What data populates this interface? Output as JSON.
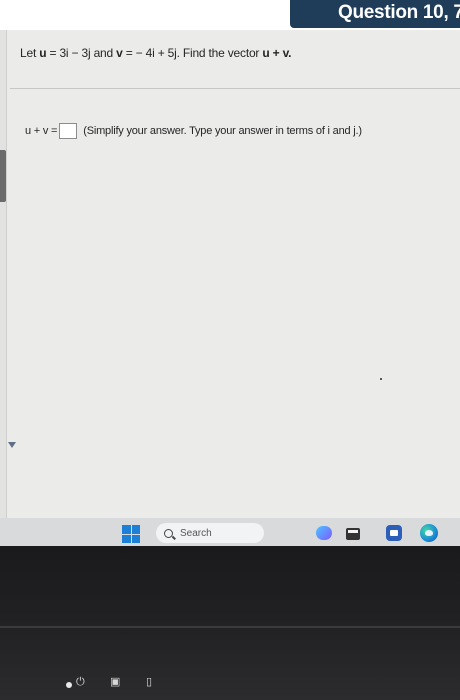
{
  "header": {
    "title": "Question 10, 7.",
    "back_label": "<"
  },
  "question": {
    "let": "Let",
    "u_name": "u",
    "eq1": " = 3i − 3j",
    "and": "and",
    "v_name": "v",
    "eq2": " = − 4i + 5j.",
    "find": "Find the vector",
    "target": "u + v."
  },
  "answer": {
    "prefix": "u + v =",
    "value": "",
    "hint": "(Simplify your answer. Type your answer in terms of i and j.)"
  },
  "taskbar": {
    "search_label": "Search"
  },
  "colors": {
    "header_bg": "#1f3c59",
    "windows_blue": "#1d7fd6"
  },
  "icons": {
    "back": "chevron-left-icon",
    "start": "windows-logo-icon",
    "search": "search-icon",
    "copilot": "copilot-icon",
    "file_explorer": "folder-icon",
    "meet": "video-icon",
    "edge": "edge-browser-icon"
  }
}
